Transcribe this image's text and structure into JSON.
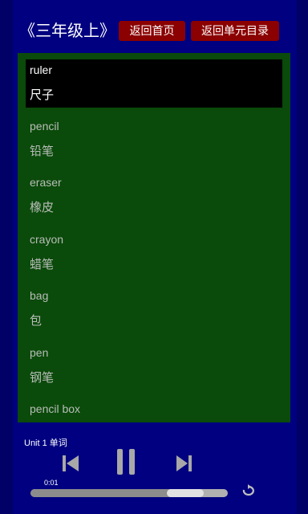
{
  "header": {
    "title": "《三年级上》",
    "home_button": "返回首页",
    "unit_list_button": "返回单元目录"
  },
  "words": [
    {
      "en": "ruler",
      "cn": "尺子",
      "active": true
    },
    {
      "en": "pencil",
      "cn": "铅笔"
    },
    {
      "en": "eraser",
      "cn": "橡皮"
    },
    {
      "en": "crayon",
      "cn": "蜡笔"
    },
    {
      "en": "bag",
      "cn": "包"
    },
    {
      "en": "pen",
      "cn": "钢笔"
    },
    {
      "en": "pencil box",
      "cn": ""
    }
  ],
  "player": {
    "unit_label": "Unit 1 单词",
    "current_time": "0:01",
    "progress": 0.72,
    "icons": [
      "skip-previous-icon",
      "pause-icon",
      "skip-next-icon",
      "repeat-icon"
    ]
  },
  "colors": {
    "background": "#000080",
    "list_background": "#0a4a0a",
    "button_red": "#8b0000",
    "active_row": "#000000"
  }
}
